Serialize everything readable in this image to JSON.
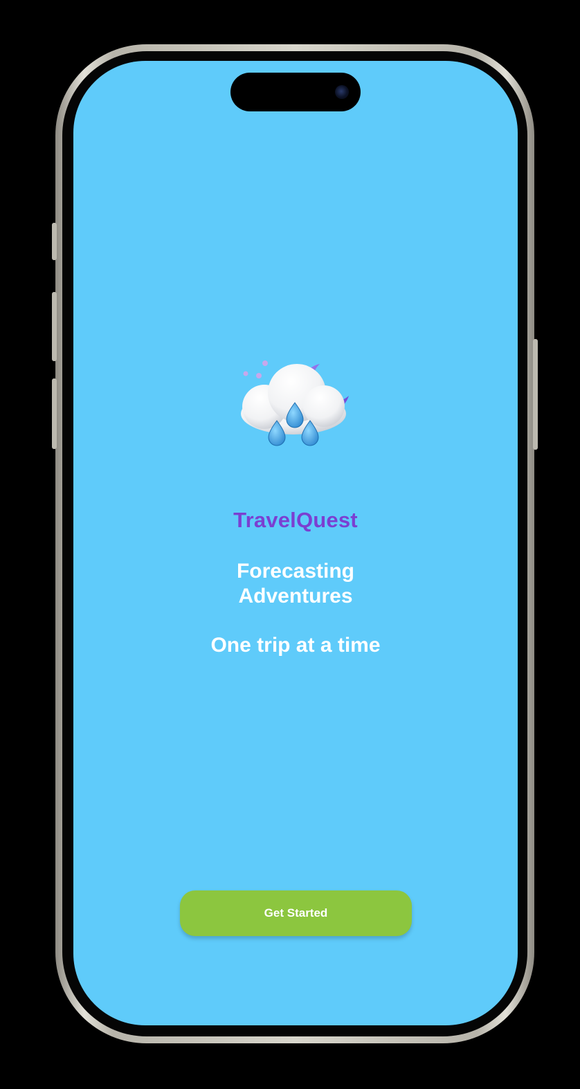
{
  "app": {
    "name": "TravelQuest",
    "tagline_line1": "Forecasting",
    "tagline_line2": "Adventures",
    "subtitle": "One trip at a time"
  },
  "cta": {
    "label": "Get Started"
  },
  "illustration": {
    "icon": "cloud-rain-moon-icon"
  },
  "colors": {
    "screen_background": "#5fcbfa",
    "title": "#7b3fd1",
    "text": "#ffffff",
    "button": "#8cc63f",
    "device_background": "#000000"
  }
}
